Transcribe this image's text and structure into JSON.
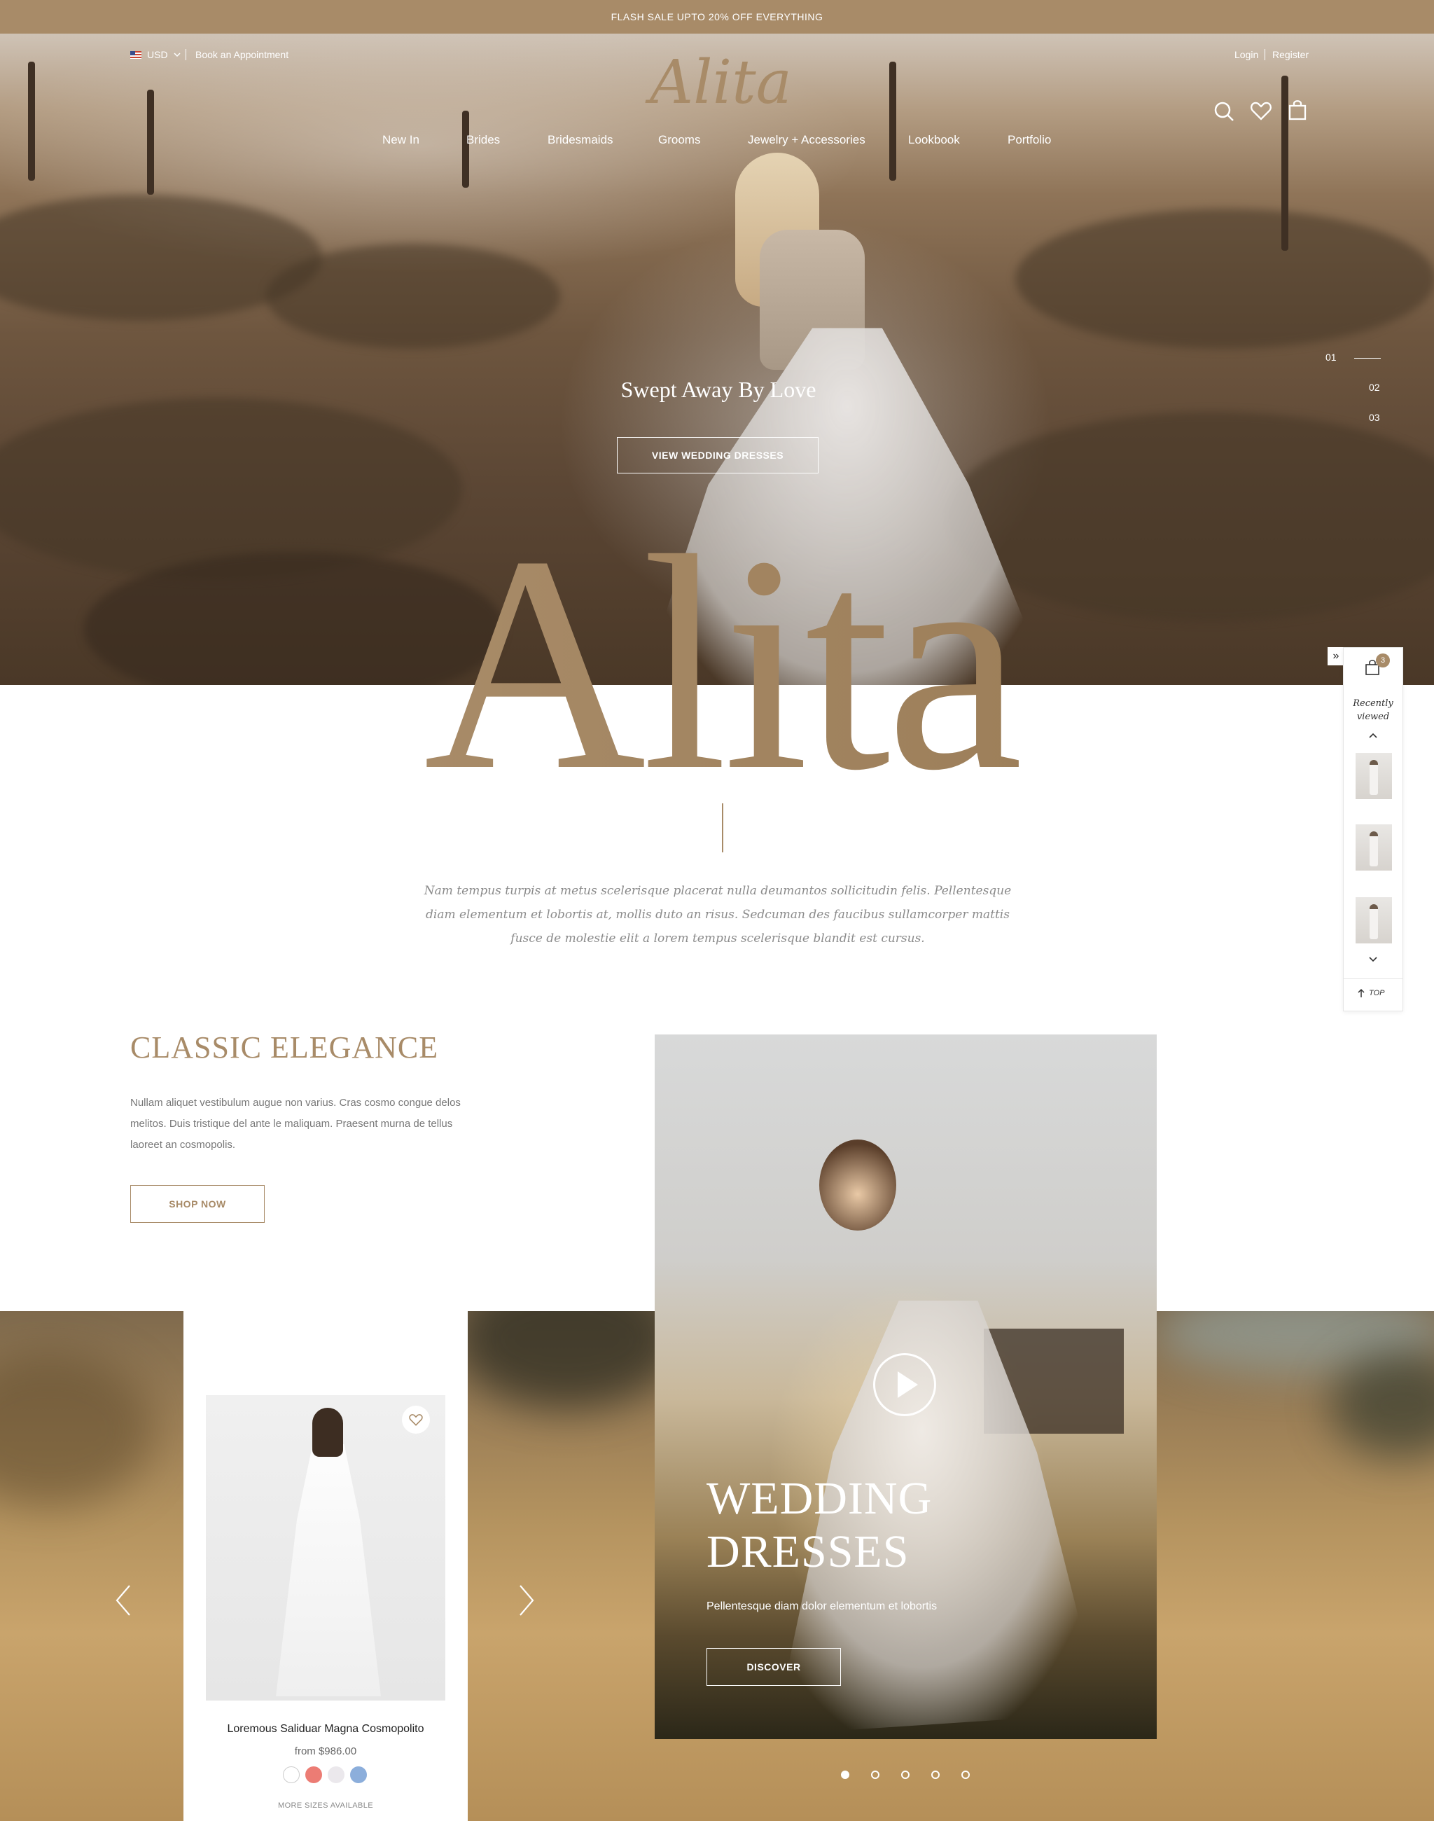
{
  "promo": {
    "text": "FLASH SALE UPTO 20% OFF EVERYTHING"
  },
  "header": {
    "currency": "USD",
    "book_appointment": "Book an Appointment",
    "login": "Login",
    "register": "Register",
    "logo": "Alita"
  },
  "nav": {
    "items": [
      "New In",
      "Brides",
      "Bridesmaids",
      "Grooms",
      "Jewelry + Accessories",
      "Lookbook",
      "Portfolio"
    ]
  },
  "hero": {
    "title": "Swept Away By Love",
    "button": "VIEW WEDDING DRESSES",
    "slides": [
      "01",
      "02",
      "03"
    ],
    "active_slide": "01"
  },
  "wordmark": "Alita",
  "intro": {
    "text": "Nam tempus turpis at metus scelerisque placerat nulla deumantos sollicitudin felis. Pellentesque diam elementum et lobortis at, mollis duto an risus. Sedcuman des faucibus sullamcorper mattis fusce de molestie elit a lorem tempus scelerisque blandit est cursus."
  },
  "classic": {
    "title": "CLASSIC ELEGANCE",
    "body": "Nullam aliquet vestibulum augue non varius. Cras cosmo congue delos melitos. Duis tristique del ante le maliquam. Praesent murna de tellus laoreet an cosmopolis.",
    "button": "SHOP NOW"
  },
  "product": {
    "name": "Loremous Saliduar Magna Cosmopolito",
    "price": "from $986.00",
    "swatches": [
      "#ffffff",
      "#ec7c74",
      "#ebe8ec",
      "#8caedb"
    ],
    "sizes_note": "MORE SIZES AVAILABLE"
  },
  "video_card": {
    "title_line1": "WEDDING",
    "title_line2": "DRESSES",
    "subtitle": "Pellentesque diam dolor elementum et lobortis",
    "button": "DISCOVER"
  },
  "carousel": {
    "dot_count": 5,
    "active_index": 0
  },
  "recently_viewed": {
    "cart_count": "3",
    "label_line1": "Recently",
    "label_line2": "viewed",
    "top_label": "TOP"
  },
  "colors": {
    "accent": "#a88b68",
    "white": "#ffffff",
    "text_muted": "#777777"
  }
}
